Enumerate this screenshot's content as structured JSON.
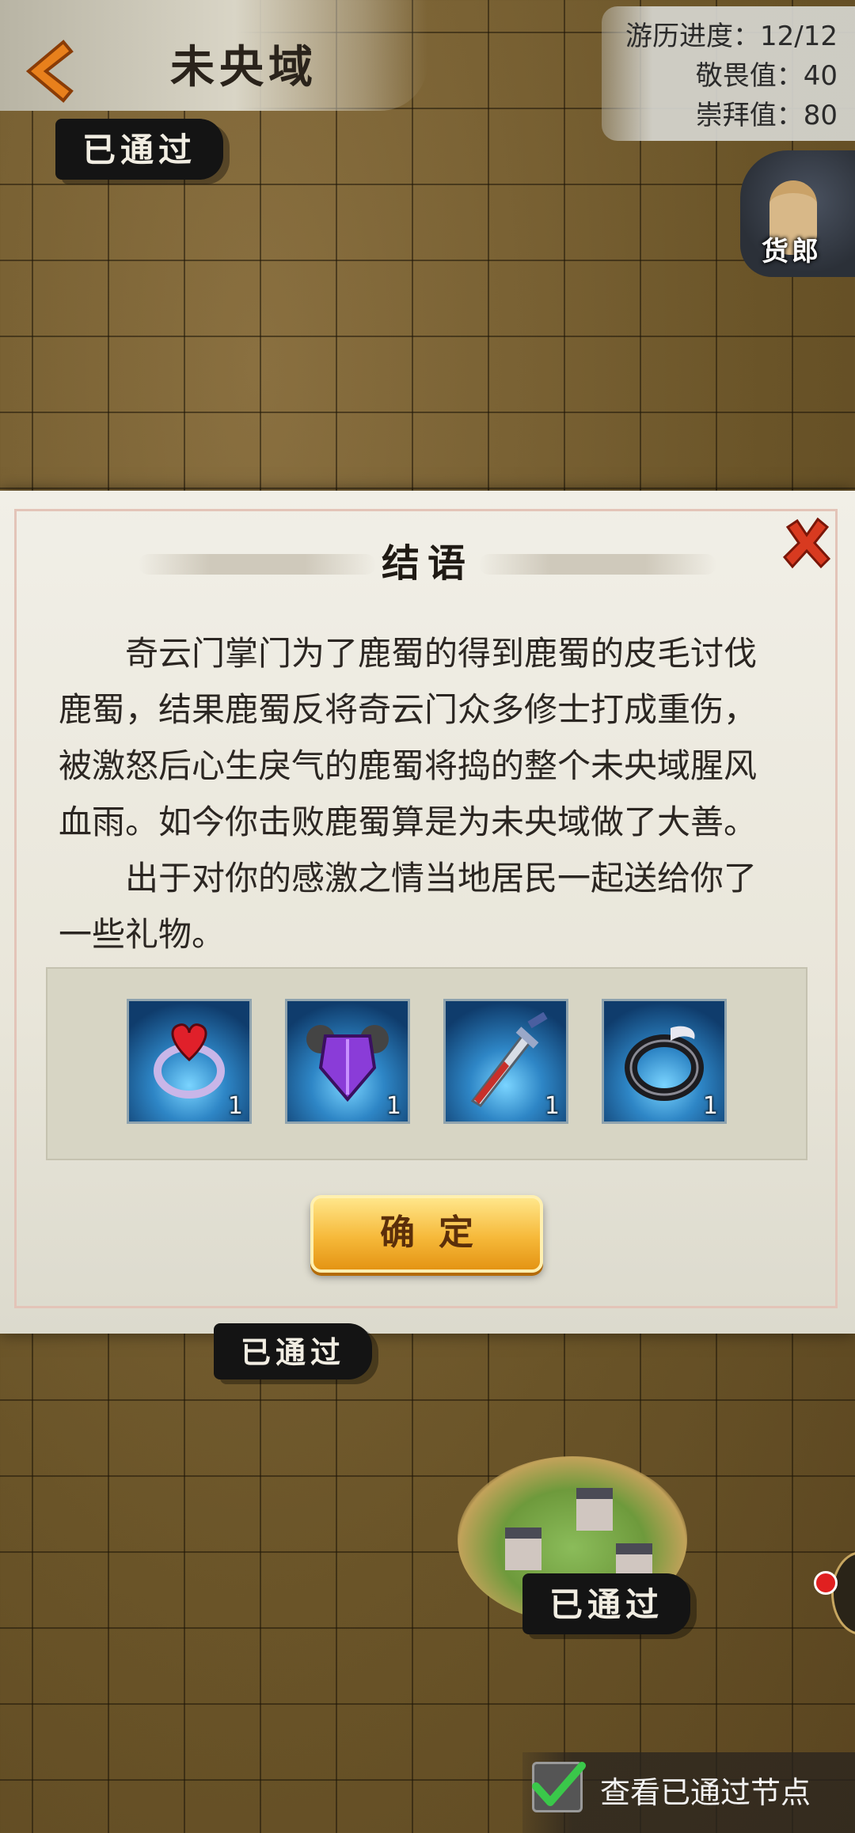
{
  "header": {
    "region_name": "未央域",
    "back": {
      "icon": "back-arrow-icon"
    }
  },
  "stats": {
    "progress": "游历进度：12/12",
    "awe": "敬畏值：40",
    "worship": "崇拜值：80"
  },
  "map": {
    "passed_label": "已通过",
    "npc_label": "货郎"
  },
  "dialog": {
    "title": "结语",
    "close_icon": "close-x-icon",
    "paragraphs": [
      "奇云门掌门为了鹿蜀的得到鹿蜀的皮毛讨伐鹿蜀，结果鹿蜀反将奇云门众多修士打成重伤，被激怒后心生戾气的鹿蜀将捣的整个未央域腥风血雨。如今你击败鹿蜀算是为未央域做了大善。",
      "出于对你的感激之情当地居民一起送给你了一些礼物。"
    ],
    "rewards": [
      {
        "icon": "heart-gem-ring-icon",
        "count": "1"
      },
      {
        "icon": "purple-armor-icon",
        "count": "1"
      },
      {
        "icon": "sword-icon",
        "count": "1"
      },
      {
        "icon": "silver-ring-icon",
        "count": "1"
      }
    ],
    "confirm_label": "确定"
  },
  "footer": {
    "view_passed_label": "查看已通过节点",
    "view_passed_checked": true
  },
  "colors": {
    "confirm_button": "#f6b93a",
    "close_x": "#d83a20",
    "map_bg": "#6f5a2e",
    "dialog_bg": "#eeebe2"
  }
}
